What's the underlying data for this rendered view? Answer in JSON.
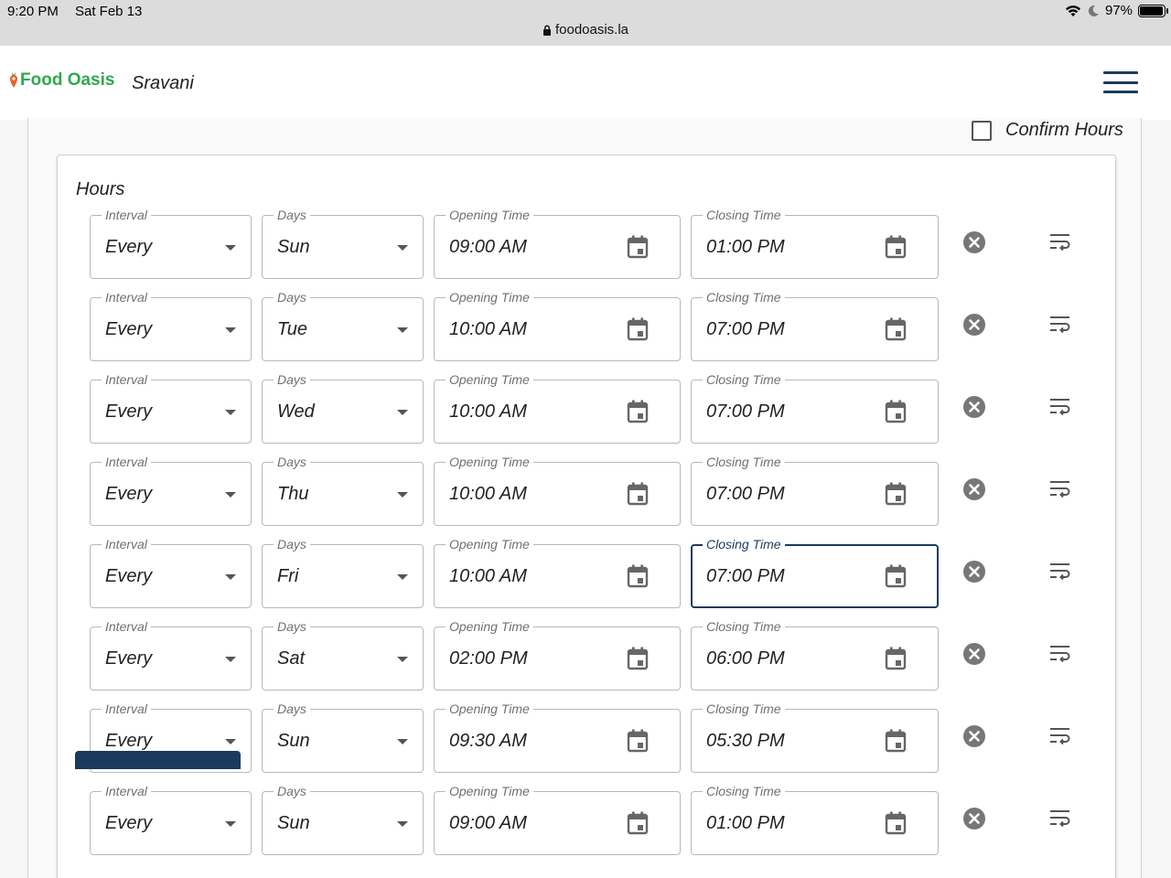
{
  "status_bar": {
    "time": "9:20 PM",
    "date": "Sat Feb 13",
    "battery": "97%",
    "battery_level": 0.97,
    "url": "foodoasis.la",
    "icons": [
      "wifi-icon",
      "moon-icon",
      "battery-icon",
      "lock-icon"
    ]
  },
  "header": {
    "logo_text": "Food Oasis",
    "user_name": "Sravani",
    "menu_icon": "hamburger-menu-icon"
  },
  "confirm_hours": {
    "label": "Confirm Hours",
    "checked": false
  },
  "hours": {
    "title": "Hours",
    "labels": {
      "interval": "Interval",
      "days": "Days",
      "opening": "Opening Time",
      "closing": "Closing Time"
    },
    "rows": [
      {
        "interval": "Every",
        "day": "Sun",
        "open": "09:00 AM",
        "close": "01:00 PM"
      },
      {
        "interval": "Every",
        "day": "Tue",
        "open": "10:00 AM",
        "close": "07:00 PM"
      },
      {
        "interval": "Every",
        "day": "Wed",
        "open": "10:00 AM",
        "close": "07:00 PM"
      },
      {
        "interval": "Every",
        "day": "Thu",
        "open": "10:00 AM",
        "close": "07:00 PM"
      },
      {
        "interval": "Every",
        "day": "Fri",
        "open": "10:00 AM",
        "close": "07:00 PM",
        "focused_field": "close"
      },
      {
        "interval": "Every",
        "day": "Sat",
        "open": "02:00 PM",
        "close": "06:00 PM"
      },
      {
        "interval": "Every",
        "day": "Sun",
        "open": "09:30 AM",
        "close": "05:30 PM"
      },
      {
        "interval": "Every",
        "day": "Sun",
        "open": "09:00 AM",
        "close": "01:00 PM"
      }
    ],
    "row_icons": [
      "calendar-icon",
      "remove-circle-icon",
      "wrap-text-icon"
    ]
  },
  "colors": {
    "brand_green": "#2fa84f",
    "accent_navy": "#1c3a5e",
    "carrot_orange": "#e8612c"
  }
}
